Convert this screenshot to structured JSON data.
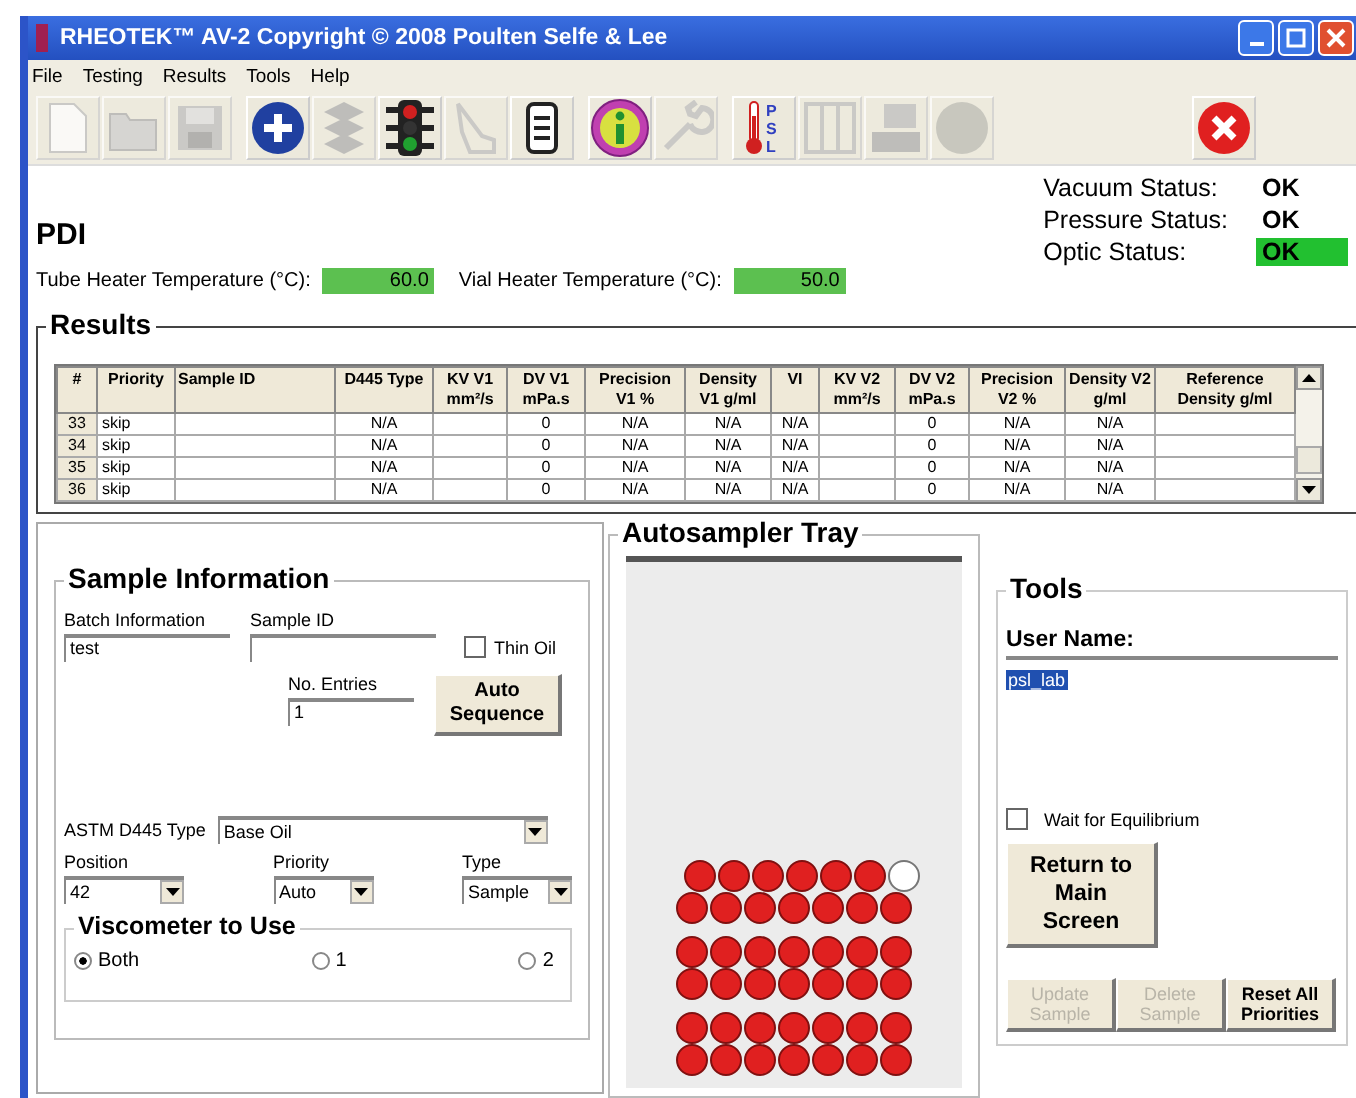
{
  "window": {
    "title": "RHEOTEK™ AV-2  Copyright © 2008 Poulten Selfe & Lee"
  },
  "menu": [
    "File",
    "Testing",
    "Results",
    "Tools",
    "Help"
  ],
  "toolbar": [
    {
      "kind": "new",
      "disabled": true
    },
    {
      "kind": "open",
      "disabled": true
    },
    {
      "kind": "save",
      "disabled": true
    },
    {
      "kind": "add",
      "disabled": false
    },
    {
      "kind": "stack",
      "disabled": true
    },
    {
      "kind": "traffic",
      "disabled": false
    },
    {
      "kind": "hand",
      "disabled": true
    },
    {
      "kind": "docs",
      "disabled": false
    },
    {
      "kind": "info",
      "disabled": false
    },
    {
      "kind": "wrench",
      "disabled": true
    },
    {
      "kind": "psl",
      "disabled": false,
      "label": "PSL"
    },
    {
      "kind": "frame",
      "disabled": true
    },
    {
      "kind": "computer",
      "disabled": true
    },
    {
      "kind": "circle",
      "disabled": true
    },
    {
      "kind": "close",
      "disabled": false
    }
  ],
  "heading": "PDI",
  "heaters": [
    {
      "label": "Tube Heater Temperature (°C):",
      "value": "60.0"
    },
    {
      "label": "Vial Heater Temperature (°C):",
      "value": "50.0"
    }
  ],
  "statuses": [
    {
      "label": "Vacuum Status:",
      "value": "OK",
      "lit": false
    },
    {
      "label": "Pressure Status:",
      "value": "OK",
      "lit": false
    },
    {
      "label": "Optic Status:",
      "value": "OK",
      "lit": true
    }
  ],
  "results": {
    "title": "Results",
    "columns": [
      "#",
      "Priority",
      "Sample ID",
      "D445 Type",
      "KV V1 mm²/s",
      "DV V1 mPa.s",
      "Precision V1 %",
      "Density V1 g/ml",
      "VI",
      "KV V2 mm²/s",
      "DV V2 mPa.s",
      "Precision V2 %",
      "Density V2 g/ml",
      "Reference Density g/ml"
    ],
    "rows": [
      [
        "33",
        "skip",
        "",
        "N/A",
        "",
        "0",
        "N/A",
        "N/A",
        "N/A",
        "",
        "0",
        "N/A",
        "N/A",
        ""
      ],
      [
        "34",
        "skip",
        "",
        "N/A",
        "",
        "0",
        "N/A",
        "N/A",
        "N/A",
        "",
        "0",
        "N/A",
        "N/A",
        ""
      ],
      [
        "35",
        "skip",
        "",
        "N/A",
        "",
        "0",
        "N/A",
        "N/A",
        "N/A",
        "",
        "0",
        "N/A",
        "N/A",
        ""
      ],
      [
        "36",
        "skip",
        "",
        "N/A",
        "",
        "0",
        "N/A",
        "N/A",
        "N/A",
        "",
        "0",
        "N/A",
        "N/A",
        ""
      ]
    ]
  },
  "sample_information": {
    "title": "Sample Information",
    "batch": {
      "label": "Batch Information",
      "value": "test"
    },
    "sample_id": {
      "label": "Sample ID"
    },
    "thin_oil": {
      "label": "Thin Oil",
      "checked": false
    },
    "entries": {
      "label": "No. Entries",
      "value": "1"
    },
    "auto_sequence": "Auto Sequence",
    "astm": {
      "label": "ASTM D445 Type",
      "value": "Base Oil"
    },
    "position": {
      "label": "Position",
      "value": "42"
    },
    "priority": {
      "label": "Priority",
      "value": "Auto"
    },
    "type": {
      "label": "Type",
      "value": "Sample"
    },
    "viscometer": {
      "title": "Viscometer to Use",
      "options": [
        {
          "label": "Both",
          "selected": true
        },
        {
          "label": "1",
          "selected": false
        },
        {
          "label": "2",
          "selected": false
        }
      ]
    }
  },
  "tray": {
    "title": "Autosampler Tray",
    "rows": [
      [
        true,
        true,
        true,
        true,
        true,
        true,
        false
      ],
      [
        true,
        true,
        true,
        true,
        true,
        true,
        true
      ],
      [
        true,
        true,
        true,
        true,
        true,
        true,
        true
      ],
      [
        true,
        true,
        true,
        true,
        true,
        true,
        true
      ],
      [
        true,
        true,
        true,
        true,
        true,
        true,
        true
      ],
      [
        true,
        true,
        true,
        true,
        true,
        true,
        true
      ]
    ]
  },
  "tools": {
    "title": "Tools",
    "user_label": "User Name:",
    "user_value": "psl_lab",
    "wait": {
      "label": "Wait for Equilibrium",
      "checked": false
    },
    "return_button": "Return to Main Screen",
    "buttons": [
      {
        "label": "Update Sample",
        "disabled": true
      },
      {
        "label": "Delete Sample",
        "disabled": true
      },
      {
        "label": "Reset All Priorities",
        "disabled": false
      }
    ]
  }
}
